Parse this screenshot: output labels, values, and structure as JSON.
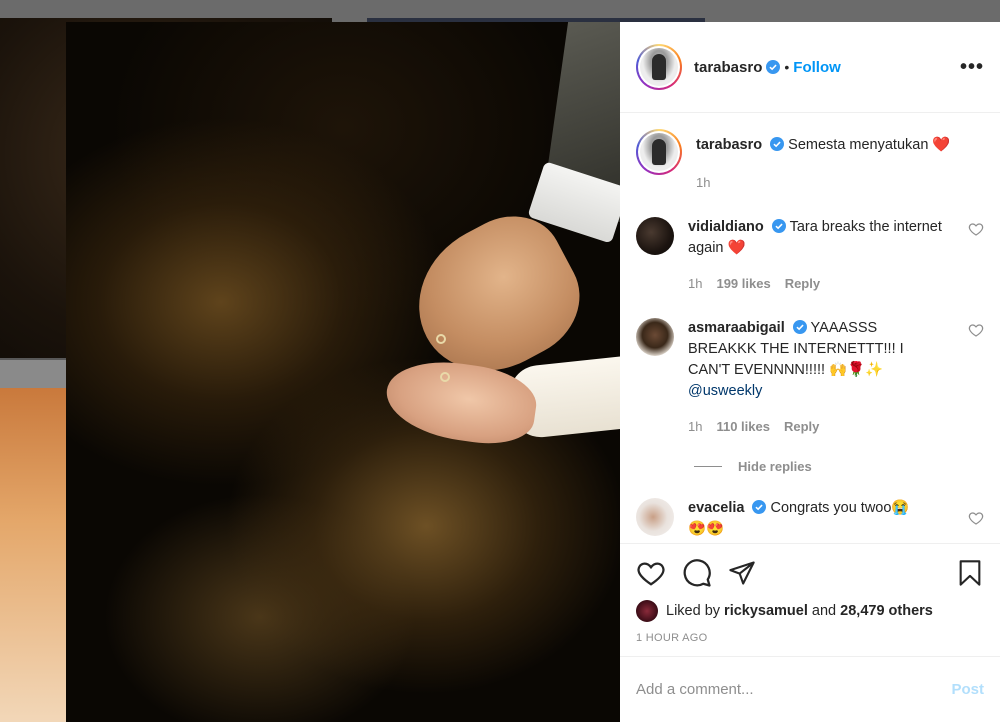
{
  "post": {
    "author": "tarabasro",
    "follow_label": "Follow",
    "separator": "•",
    "more_label": "•••",
    "caption": {
      "user": "tarabasro",
      "text": "Semesta menyatukan ❤️",
      "time": "1h"
    }
  },
  "comments": [
    {
      "user": "vidialdiano",
      "text": "Tara breaks the internet again ❤️",
      "time": "1h",
      "likes": "199 likes",
      "reply": "Reply"
    },
    {
      "user": "asmaraabigail",
      "text": "YAAASSS BREAKKK THE INTERNETTT!!! I CAN'T EVENNNN!!!!! 🙌🌹✨",
      "mention": "@usweekly",
      "time": "1h",
      "likes": "110 likes",
      "reply": "Reply"
    },
    {
      "user": "evacelia",
      "text": "Congrats you twoo😭",
      "text2": "😍😍"
    }
  ],
  "hide_replies": "Hide replies",
  "engagement": {
    "liked_by_prefix": "Liked by",
    "liked_by_user": "ricky​samuel",
    "liked_by_and": "and",
    "liked_by_count": "28,479 others",
    "timestamp": "1 HOUR AGO"
  },
  "composer": {
    "placeholder": "Add a comment...",
    "post_label": "Post"
  },
  "icons": [
    "heart-icon",
    "comment-icon",
    "share-icon",
    "bookmark-icon",
    "verified-icon",
    "more-icon"
  ],
  "colors": {
    "accent": "#0095f6",
    "verified": "#3897f0",
    "muted": "#8e8e8e",
    "post_disabled": "#b2dffc"
  }
}
